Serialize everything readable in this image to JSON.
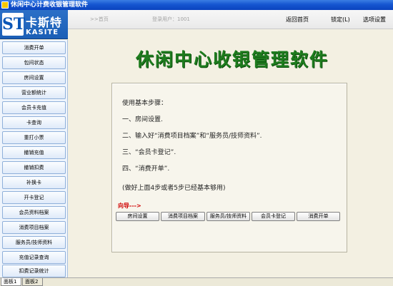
{
  "window": {
    "title": "休闲中心计费收银管理软件"
  },
  "logo": {
    "brand_cn": "卡斯特",
    "brand_en": "KASITE",
    "mark": "ST"
  },
  "header": {
    "home_link": ">>首页",
    "user": "登录用户：1001",
    "back_home": "返回首页",
    "lock": "锁定(L)",
    "options": "选项设置"
  },
  "sidebar": {
    "items": [
      {
        "label": "消费开单"
      },
      {
        "label": "包间状态"
      },
      {
        "label": "房间设置"
      },
      {
        "label": "营业额统计"
      },
      {
        "label": "会员卡充值"
      },
      {
        "label": "卡查询"
      },
      {
        "label": "重打小票"
      },
      {
        "label": "撤销充值"
      },
      {
        "label": "撤销扣费"
      },
      {
        "label": "补换卡"
      },
      {
        "label": "开卡登记"
      },
      {
        "label": "会员资料档案"
      },
      {
        "label": "消费项目档案"
      },
      {
        "label": "服务员/技师资料"
      },
      {
        "label": "充值记录查询"
      },
      {
        "label": "扣费记录统计"
      }
    ]
  },
  "main": {
    "title": "休闲中心收银管理软件",
    "steps": [
      "使用基本步骤：",
      "一、房间设置.",
      "二、输入好“消费项目档案”和“服务员/技师资料”.",
      "三、“会员卡登记”.",
      "四、“消费开单”.",
      "(做好上面4步或者5步已经基本够用)"
    ],
    "guide": "向导--->",
    "buttons": [
      {
        "label": "房间设置"
      },
      {
        "label": "消费项目档案"
      },
      {
        "label": "服务员/技师资料"
      },
      {
        "label": "会员卡登记"
      },
      {
        "label": "消费开单"
      }
    ]
  },
  "tabs": [
    {
      "label": "面板1"
    },
    {
      "label": "面板2"
    }
  ]
}
